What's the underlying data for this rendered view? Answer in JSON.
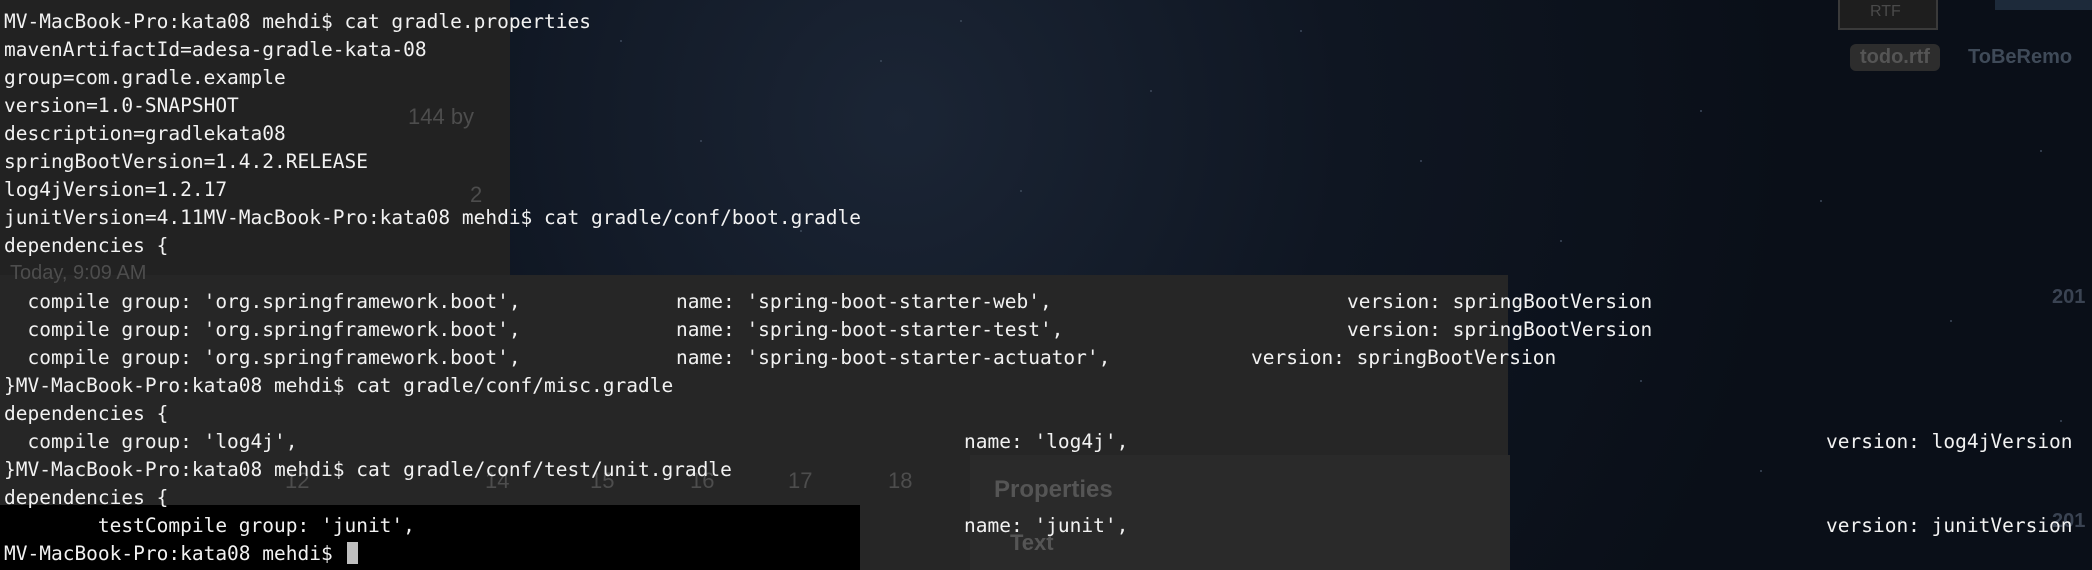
{
  "background": {
    "color": "#0d1420",
    "ghost_text": {
      "size_label": "144 by",
      "count_label": "2",
      "date_label": "Today, 9:09 AM",
      "ruler_17": "17",
      "ruler_18": "18",
      "ruler_16": "16",
      "ruler_15": "15",
      "ruler_14": "14",
      "ruler_12": "12",
      "properties_title": "Properties",
      "text_section": "Text",
      "year_fragment_1": "201",
      "year_fragment_2": "201"
    },
    "desktop_icons": {
      "rtf_badge": "RTF",
      "todo_file": "todo.rtf",
      "tobe_folder": "ToBeRemo"
    }
  },
  "terminal": {
    "text_color": "#f2f2f2",
    "cursor_color": "#bfbfbf",
    "lines": [
      {
        "segments": [
          {
            "text": "MV-MacBook-Pro:kata08 mehdi$ cat gradle.properties"
          }
        ]
      },
      {
        "segments": [
          {
            "text": "mavenArtifactId=adesa-gradle-kata-08"
          }
        ]
      },
      {
        "segments": [
          {
            "text": "group=com.gradle.example"
          }
        ]
      },
      {
        "segments": [
          {
            "text": "version=1.0-SNAPSHOT"
          }
        ]
      },
      {
        "segments": [
          {
            "text": "description=gradlekata08"
          }
        ]
      },
      {
        "segments": [
          {
            "text": "springBootVersion=1.4.2.RELEASE"
          }
        ]
      },
      {
        "segments": [
          {
            "text": "log4jVersion=1.2.17"
          }
        ]
      },
      {
        "segments": [
          {
            "text": "junitVersion=4.11MV-MacBook-Pro:kata08 mehdi$ cat gradle/conf/boot.gradle"
          }
        ]
      },
      {
        "segments": [
          {
            "text": "dependencies {"
          }
        ]
      },
      {
        "segments": [
          {
            "text": ""
          }
        ]
      },
      {
        "segments": [
          {
            "text": "  compile group: 'org.springframework.boot',"
          },
          {
            "text": "name: 'spring-boot-starter-web',"
          },
          {
            "text": "version: springBootVersion"
          }
        ]
      },
      {
        "segments": [
          {
            "text": "  compile group: 'org.springframework.boot',"
          },
          {
            "text": "name: 'spring-boot-starter-test',"
          },
          {
            "text": "version: springBootVersion"
          }
        ]
      },
      {
        "segments": [
          {
            "text": "  compile group: 'org.springframework.boot',"
          },
          {
            "text": "name: 'spring-boot-starter-actuator',"
          },
          {
            "text": "version: springBootVersion"
          }
        ]
      },
      {
        "segments": [
          {
            "text": "}MV-MacBook-Pro:kata08 mehdi$ cat gradle/conf/misc.gradle"
          }
        ]
      },
      {
        "segments": [
          {
            "text": "dependencies {"
          }
        ]
      },
      {
        "segments": [
          {
            "text": "  compile group: 'log4j',"
          },
          {
            "text": "name: 'log4j',"
          },
          {
            "text": "version: log4jVersion"
          }
        ]
      },
      {
        "segments": [
          {
            "text": "}MV-MacBook-Pro:kata08 mehdi$ cat gradle/conf/test/unit.gradle"
          }
        ]
      },
      {
        "segments": [
          {
            "text": "dependencies {"
          }
        ]
      },
      {
        "segments": [
          {
            "text": "        testCompile group: 'junit',"
          },
          {
            "text": "name: 'junit',"
          },
          {
            "text": "version: junitVersion"
          }
        ]
      },
      {
        "segments": [
          {
            "text": "MV-MacBook-Pro:kata08 mehdi$ "
          }
        ],
        "cursor": true
      }
    ]
  }
}
